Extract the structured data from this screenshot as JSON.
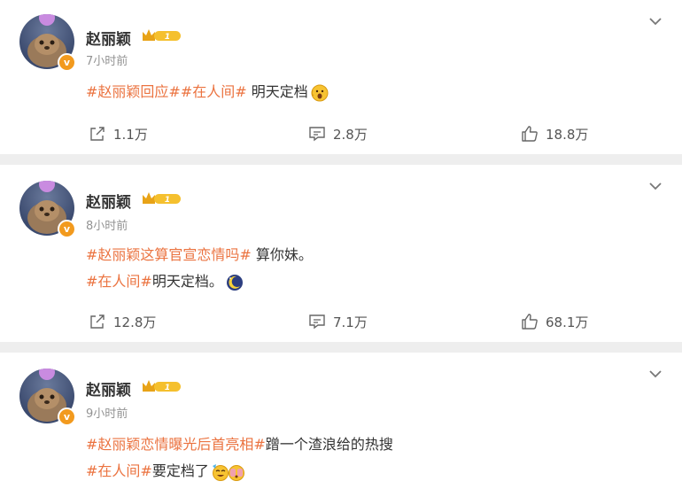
{
  "posts": [
    {
      "author": "赵丽颖",
      "level_badge": "1",
      "time": "7小时前",
      "lines": [
        {
          "tag": "#赵丽颖回应##在人间#",
          "text": " 明天定档"
        }
      ],
      "emoji": "surprised-face-icon",
      "forwards": "1.1万",
      "comments": "2.8万",
      "likes": "18.8万"
    },
    {
      "author": "赵丽颖",
      "level_badge": "1",
      "time": "8小时前",
      "lines": [
        {
          "tag": "#赵丽颖这算官宣恋情吗#",
          "text": " 算你妹。"
        },
        {
          "tag": "#在人间#",
          "text": "明天定档。"
        }
      ],
      "emoji": "moon-icon",
      "forwards": "12.8万",
      "comments": "7.1万",
      "likes": "68.1万"
    },
    {
      "author": "赵丽颖",
      "level_badge": "1",
      "time": "9小时前",
      "lines": [
        {
          "tag": "#赵丽颖恋情曝光后首亮相#",
          "text": "蹭一个渣浪给的热搜"
        },
        {
          "tag": "#在人间#",
          "text": "要定档了"
        }
      ],
      "emoji": "party-faces-icon"
    }
  ],
  "colors": {
    "tag": "#eb7340",
    "verified": "#f29a1e",
    "gold_badge": "#f5c02e"
  }
}
